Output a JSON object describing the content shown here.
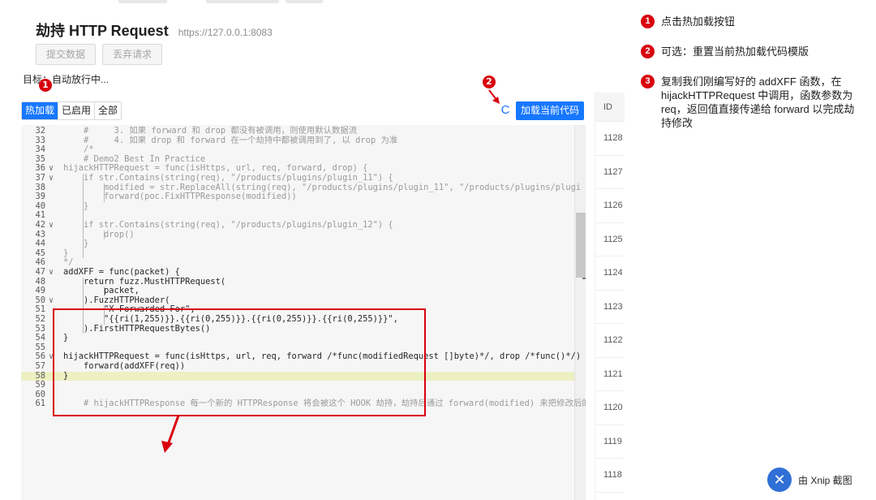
{
  "header": {
    "title": "劫持 HTTP Request",
    "url": "https://127.0.0.1:8083"
  },
  "actions": {
    "submit_label": "提交数据",
    "discard_label": "丢弃请求"
  },
  "target_text": "目标：自动放行中...",
  "tabs": [
    {
      "label": "热加载",
      "active": true
    },
    {
      "label": "已启用",
      "active": false
    },
    {
      "label": "全部",
      "active": false
    }
  ],
  "editor": {
    "load_label": "加载当前代码",
    "refresh_glyph": "C",
    "lines": [
      {
        "n": "32",
        "text": "    #     3. 如果 forward 和 drop 都没有被调用，则使用默认数据流"
      },
      {
        "n": "33",
        "text": "    #     4. 如果 drop 和 forward 在一个劫持中都被调用到了, 以 drop 为准"
      },
      {
        "n": "34",
        "text": "    /*"
      },
      {
        "n": "35",
        "text": "    # Demo2 Best In Practice"
      },
      {
        "n": "36",
        "text": "hijackHTTPRequest = func(isHttps, url, req, forward, drop) {"
      },
      {
        "n": "37",
        "text": "    if str.Contains(string(req), \"/products/plugins/plugin_11\") {"
      },
      {
        "n": "38",
        "text": "        modified = str.ReplaceAll(string(req), \"/products/plugins/plugin_11\", \"/products/plugins/plugi"
      },
      {
        "n": "39",
        "text": "        forward(poc.FixHTTPResponse(modified))"
      },
      {
        "n": "40",
        "text": "    }"
      },
      {
        "n": "41",
        "text": ""
      },
      {
        "n": "42",
        "text": "    if str.Contains(string(req), \"/products/plugins/plugin_12\") {"
      },
      {
        "n": "43",
        "text": "        drop()"
      },
      {
        "n": "44",
        "text": "    }"
      },
      {
        "n": "45",
        "text": "}"
      },
      {
        "n": "46",
        "text": "*/"
      },
      {
        "n": "47",
        "text": "addXFF = func(packet) {"
      },
      {
        "n": "48",
        "text": "    return fuzz.MustHTTPRequest("
      },
      {
        "n": "49",
        "text": "        packet,"
      },
      {
        "n": "50",
        "text": "    ).FuzzHTTPHeader("
      },
      {
        "n": "51",
        "text": "        \"X-Forwarded-For\","
      },
      {
        "n": "52",
        "text": "        \"{{ri(1,255)}}.{{ri(0,255)}}.{{ri(0,255)}}.{{ri(0,255)}}\","
      },
      {
        "n": "53",
        "text": "    ).FirstHTTPRequestBytes()"
      },
      {
        "n": "54",
        "text": "}"
      },
      {
        "n": "55",
        "text": ""
      },
      {
        "n": "56",
        "text": "hijackHTTPRequest = func(isHttps, url, req, forward /*func(modifiedRequest []byte)*/, drop /*func()*/)"
      },
      {
        "n": "57",
        "text": "    forward(addXFF(req))"
      },
      {
        "n": "58",
        "text": "}"
      },
      {
        "n": "59",
        "text": ""
      },
      {
        "n": "60",
        "text": ""
      },
      {
        "n": "61",
        "text": "    # hijackHTTPResponse 每一个新的 HTTPResponse 将会被这个 HOOK 劫持，劫持后通过 forward(modified) 来把修改后的请求"
      }
    ]
  },
  "id_column": {
    "header": "ID",
    "values": [
      "1128",
      "1127",
      "1126",
      "1125",
      "1124",
      "1123",
      "1122",
      "1121",
      "1120",
      "1119",
      "1118"
    ]
  },
  "badges": [
    "1",
    "2",
    "3"
  ],
  "notes": [
    {
      "num": "1",
      "text": "点击热加载按钮"
    },
    {
      "num": "2",
      "text": "可选：重置当前热加载代码模版"
    },
    {
      "num": "3",
      "text": "复制我们刚编写好的 addXFF 函数，在 hijackHTTPRequest 中调用，函数参数为 req，返回值直接传递给 forward 以完成劫持修改"
    }
  ],
  "watermark": {
    "text": "由 Xnip 截图",
    "logo_glyph": "✕"
  },
  "colors": {
    "accent": "#1677ff",
    "annotation": "#d9000d",
    "highlight": "#ecf0c2"
  }
}
